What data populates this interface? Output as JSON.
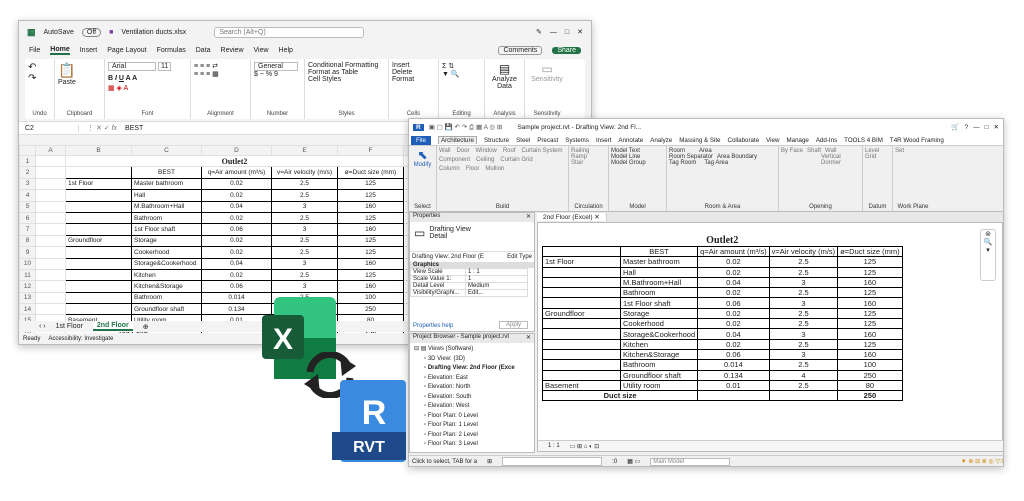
{
  "excel": {
    "autosave": "AutoSave",
    "autosave_state": "Off",
    "filename": "Ventilation ducts.xlsx",
    "search_placeholder": "Search (Alt+Q)",
    "menu": [
      "File",
      "Home",
      "Insert",
      "Page Layout",
      "Formulas",
      "Data",
      "Review",
      "View",
      "Help"
    ],
    "comments": "Comments",
    "share": "Share",
    "font": "Arial",
    "font_size": "11",
    "number_format": "General",
    "ribbon_labels": {
      "undo": "Undo",
      "clipboard": "Clipboard",
      "paste": "Paste",
      "font": "Font",
      "alignment": "Alignment",
      "number": "Number",
      "styles": "Styles",
      "cells": "Cells",
      "editing": "Editing",
      "analysis": "Analysis",
      "sensitivity": "Sensitivity",
      "cond": "Conditional Formatting",
      "fmt_table": "Format as Table",
      "cell_styles": "Cell Styles",
      "insert": "Insert",
      "delete": "Delete",
      "format": "Format",
      "analyze": "Analyze Data",
      "sensitivity_btn": "Sensitivity"
    },
    "cell_ref": "C2",
    "formula": "BEST",
    "cols": [
      "A",
      "B",
      "C",
      "D",
      "E",
      "F",
      "G"
    ],
    "tabs": [
      "1st Floor",
      "2nd Floor"
    ],
    "status": "Ready",
    "accessibility": "Accessibility: Investigate"
  },
  "sheet": {
    "title": "Outlet2",
    "headers": [
      "BEST",
      "q=Air amount (m³/s)",
      "v=Air velocity (m/s)",
      "ø=Duct size (mm)"
    ],
    "rows": [
      [
        "1st Floor",
        "Master bathroom",
        "0.02",
        "2.5",
        "125"
      ],
      [
        "",
        "Hall",
        "0.02",
        "2.5",
        "125"
      ],
      [
        "",
        "M.Bathroom+Hall",
        "0.04",
        "3",
        "160"
      ],
      [
        "",
        "Bathroom",
        "0.02",
        "2.5",
        "125"
      ],
      [
        "",
        "1st Floor shaft",
        "0.06",
        "3",
        "160"
      ],
      [
        "Groundfloor",
        "Storage",
        "0.02",
        "2.5",
        "125"
      ],
      [
        "",
        "Cookerhood",
        "0.02",
        "2.5",
        "125"
      ],
      [
        "",
        "Storage&Cookerhood",
        "0.04",
        "3",
        "160"
      ],
      [
        "",
        "Kitchen",
        "0.02",
        "2.5",
        "125"
      ],
      [
        "",
        "Kitchen&Storage",
        "0.06",
        "3",
        "160"
      ],
      [
        "",
        "Bathroom",
        "0.014",
        "2.5",
        "100"
      ],
      [
        "",
        "Groundfloor shaft",
        "0.134",
        "4",
        "250"
      ],
      [
        "Basement",
        "Utility room",
        "0.01",
        "2.5",
        "80"
      ]
    ],
    "total_label": "Duct size",
    "total": "250"
  },
  "revit": {
    "title": "Sample project.rvt - Drafting View: 2nd Fl...",
    "menu": [
      "File",
      "Architecture",
      "Structure",
      "Steel",
      "Precast",
      "Systems",
      "Insert",
      "Annotate",
      "Analyze",
      "Massing & Site",
      "Collaborate",
      "View",
      "Manage",
      "Add-Ins",
      "TOOLS 4 BIM",
      "T4R Wood Framing"
    ],
    "ribbon": {
      "modify": "Modify",
      "select": "Select",
      "wall": "Wall",
      "door": "Door",
      "window": "Window",
      "component": "Component",
      "column": "Column",
      "roof": "Roof",
      "ceiling": "Ceiling",
      "floor": "Floor",
      "curtain_system": "Curtain System",
      "curtain_grid": "Curtain Grid",
      "mullion": "Mullion",
      "railing": "Railing",
      "ramp": "Ramp",
      "stair": "Stair",
      "model_text": "Model Text",
      "model_line": "Model Line",
      "model_group": "Model Group",
      "room": "Room",
      "room_sep": "Room Separator",
      "tag_room": "Tag Room",
      "area": "Area",
      "area_boundary": "Area Boundary",
      "tag_area": "Tag Area",
      "by_face": "By Face",
      "shaft": "Shaft",
      "wall_op": "Wall",
      "vertical": "Vertical",
      "dormer": "Dormer",
      "level": "Level",
      "grid": "Grid",
      "set": "Set",
      "build": "Build",
      "circulation": "Circulation",
      "model": "Model",
      "room_area": "Room & Area",
      "opening": "Opening",
      "datum": "Datum",
      "work_plane": "Work Plane"
    },
    "properties": {
      "title": "Properties",
      "type": "Drafting View",
      "type2": "Detail",
      "selector": "Drafting View: 2nd Floor (E",
      "edit_type": "Edit Type",
      "section": "Graphics",
      "rows": [
        [
          "View Scale",
          "1 : 1"
        ],
        [
          "Scale Value  1:",
          "1"
        ],
        [
          "Detail Level",
          "Medium"
        ],
        [
          "Visibility/Graphi...",
          "Edit..."
        ]
      ],
      "help": "Properties help",
      "apply": "Apply"
    },
    "browser": {
      "title": "Project Browser - Sample project.rvt",
      "items": [
        "Views (Software)",
        "3D View: {3D}",
        "Drafting View: 2nd Floor (Exce",
        "Elevation: East",
        "Elevation: North",
        "Elevation: South",
        "Elevation: West",
        "Floor Plan: 0 Level",
        "Floor Plan: 1 Level",
        "Floor Plan: 2 Level",
        "Floor Plan: 3 Level"
      ]
    },
    "view_tab": "2nd Floor (Excel)",
    "scale": "1 : 1",
    "status": "Click to select, TAB for a",
    "status_zero": ":0",
    "main_model": "Main Model"
  },
  "logos": {
    "excel": "X",
    "revit": "R",
    "rvt": "RVT"
  },
  "colors": {
    "excel_green": "#217346",
    "revit_blue": "#1e5eb8"
  }
}
